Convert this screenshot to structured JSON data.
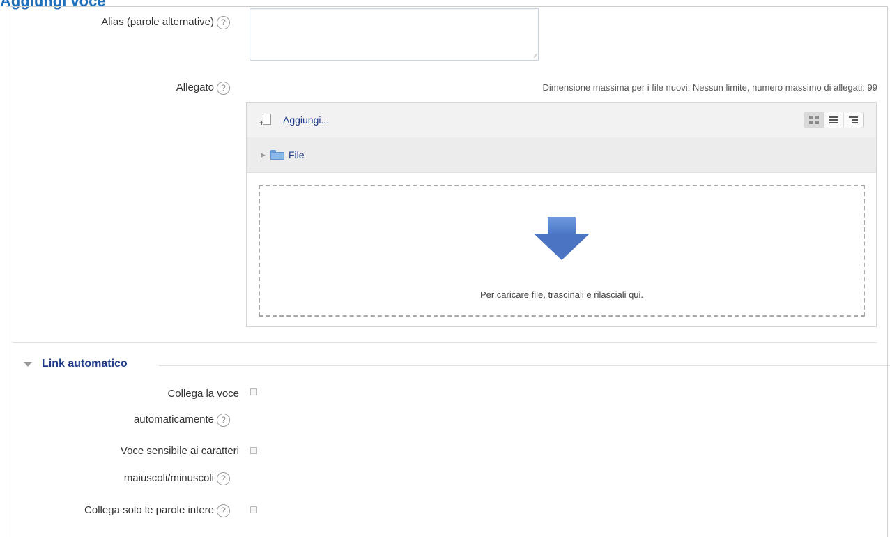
{
  "page": {
    "title": "Aggiungi voce"
  },
  "fields": {
    "alias": {
      "label": "Alias (parole alternative)",
      "value": ""
    },
    "attachment": {
      "label": "Allegato",
      "limit_text": "Dimensione massima per i file nuovi: Nessun limite, numero massimo di allegati: 99",
      "add_label": "Aggiungi...",
      "path_label": "File",
      "drop_text": "Per caricare file, trascinali e rilasciali qui."
    }
  },
  "section": {
    "title": "Link automatico",
    "items": [
      {
        "label_line1": "Collega la voce",
        "label_line2": "automaticamente",
        "checked": false
      },
      {
        "label_line1": "Voce sensibile ai caratteri",
        "label_line2": "maiuscoli/minuscoli",
        "checked": false
      },
      {
        "label_line1": "Collega solo le parole intere",
        "checked": false
      }
    ]
  },
  "icons": {
    "help": "help-circle-icon",
    "add": "add-file-icon",
    "folder": "folder-icon",
    "drop": "arrow-down-icon",
    "views": [
      "icons-view-icon",
      "list-view-icon",
      "tree-view-icon"
    ]
  },
  "colors": {
    "title": "#1f6fba",
    "link": "#1f3a8a",
    "arrow": "#4b74c2"
  }
}
